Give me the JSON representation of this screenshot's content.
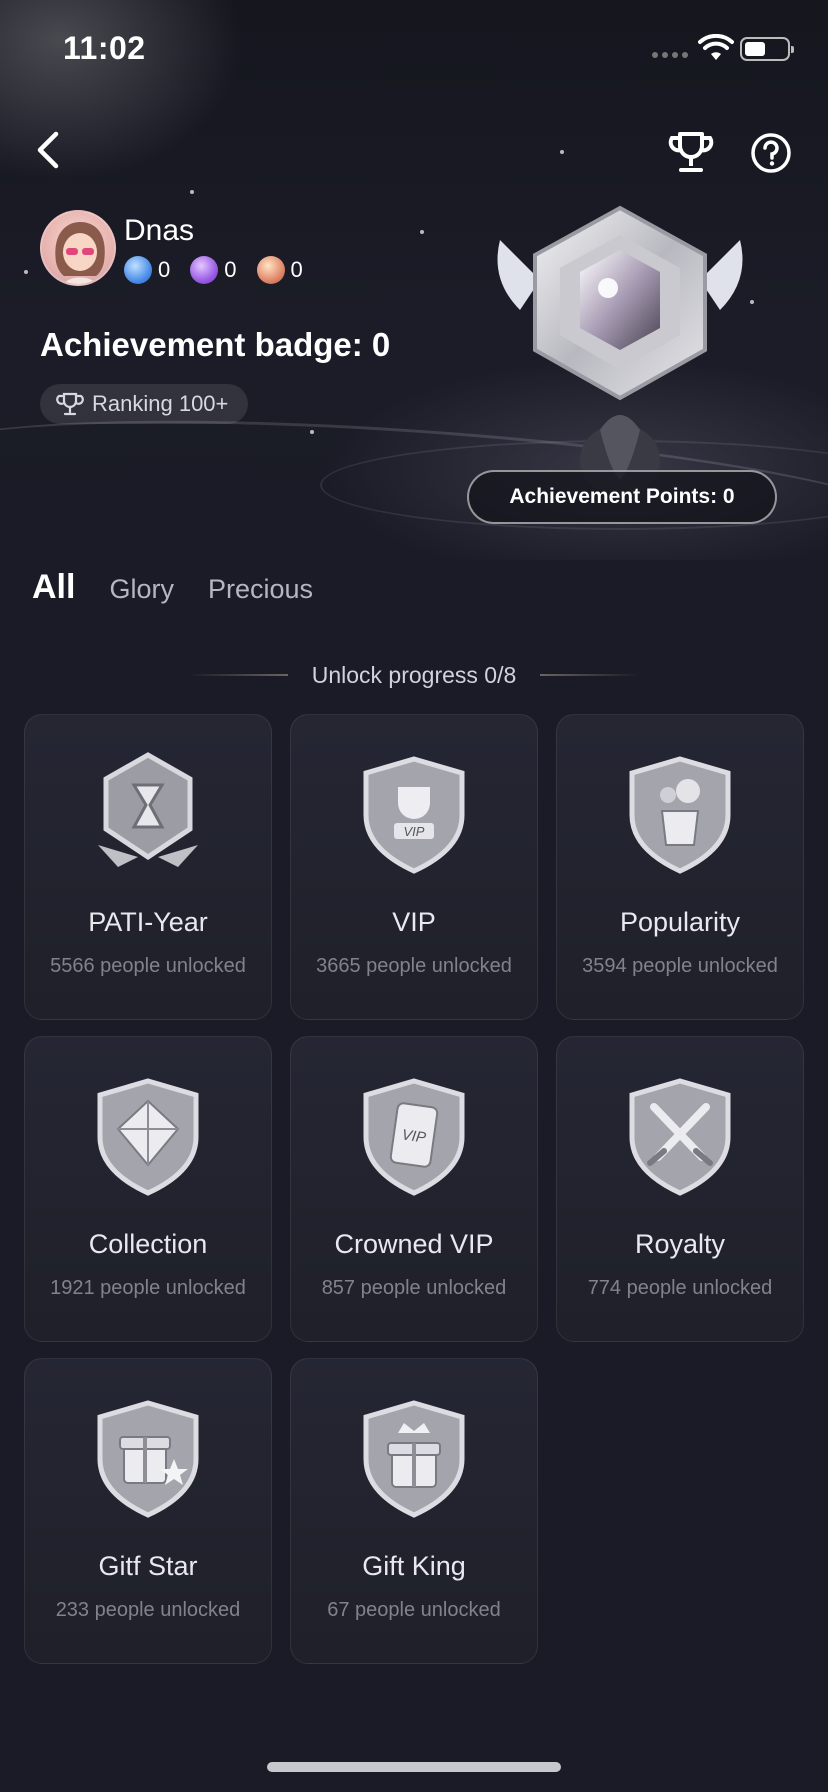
{
  "status_bar": {
    "time": "11:02"
  },
  "profile": {
    "username": "Dnas",
    "medals": [
      {
        "icon": "medal-tier-1-icon",
        "color": "#4d8fe8",
        "count": "0"
      },
      {
        "icon": "medal-tier-2-icon",
        "color": "#9b5de5",
        "count": "0"
      },
      {
        "icon": "medal-tier-3-icon",
        "color": "#e0876a",
        "count": "0"
      }
    ],
    "badge_title": "Achievement badge: 0",
    "ranking": "Ranking 100+",
    "points": "Achievement Points: 0"
  },
  "tabs": [
    {
      "label": "All",
      "active": true
    },
    {
      "label": "Glory",
      "active": false
    },
    {
      "label": "Precious",
      "active": false
    }
  ],
  "progress": {
    "label": "Unlock progress 0/8"
  },
  "badges": [
    {
      "name": "PATI-Year",
      "sub": "5566 people unlocked",
      "icon": "hourglass-badge-icon"
    },
    {
      "name": "VIP",
      "sub": "3665 people unlocked",
      "icon": "vip-trophy-badge-icon"
    },
    {
      "name": "Popularity",
      "sub": "3594 people unlocked",
      "icon": "flower-vase-badge-icon"
    },
    {
      "name": "Collection",
      "sub": "1921 people unlocked",
      "icon": "diamond-badge-icon"
    },
    {
      "name": "Crowned VIP",
      "sub": "857 people unlocked",
      "icon": "vip-card-badge-icon"
    },
    {
      "name": "Royalty",
      "sub": "774 people unlocked",
      "icon": "crossed-swords-badge-icon"
    },
    {
      "name": "Gitf Star",
      "sub": "233 people unlocked",
      "icon": "gift-star-badge-icon"
    },
    {
      "name": "Gift King",
      "sub": "67 people unlocked",
      "icon": "gift-king-badge-icon"
    }
  ]
}
